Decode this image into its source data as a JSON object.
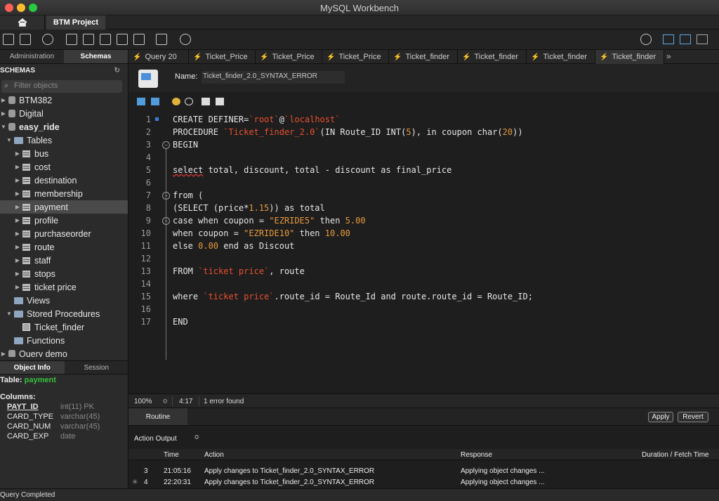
{
  "window": {
    "title": "MySQL Workbench"
  },
  "top_tabs": {
    "project": "BTM Project"
  },
  "sidebar": {
    "tabs": [
      "Administration",
      "Schemas"
    ],
    "header": "SCHEMAS",
    "filter_placeholder": "Filter objects",
    "tree": [
      {
        "label": "BTM382",
        "kind": "db",
        "expanded": false
      },
      {
        "label": "Digital",
        "kind": "db",
        "expanded": false
      },
      {
        "label": "easy_ride",
        "kind": "db",
        "expanded": true
      },
      {
        "label": "Tables",
        "kind": "folder",
        "expanded": true
      },
      {
        "label": "bus",
        "kind": "table"
      },
      {
        "label": "cost",
        "kind": "table"
      },
      {
        "label": "destination",
        "kind": "table"
      },
      {
        "label": "membership",
        "kind": "table"
      },
      {
        "label": "payment",
        "kind": "table",
        "selected": true
      },
      {
        "label": "profile",
        "kind": "table"
      },
      {
        "label": "purchaseorder",
        "kind": "table"
      },
      {
        "label": "route",
        "kind": "table"
      },
      {
        "label": "staff",
        "kind": "table"
      },
      {
        "label": "stops",
        "kind": "table"
      },
      {
        "label": "ticket price",
        "kind": "table"
      },
      {
        "label": "Views",
        "kind": "folder"
      },
      {
        "label": "Stored Procedures",
        "kind": "folder",
        "expanded": true
      },
      {
        "label": "Ticket_finder",
        "kind": "proc"
      },
      {
        "label": "Functions",
        "kind": "folder"
      },
      {
        "label": "Query demo",
        "kind": "db"
      }
    ],
    "info_tabs": [
      "Object Info",
      "Session"
    ],
    "info": {
      "table_label": "Table:",
      "table_name": "payment",
      "columns_label": "Columns:",
      "columns": [
        {
          "name": "PAYT_ID",
          "type": "int(11) PK",
          "pk": true
        },
        {
          "name": "CARD_TYPE",
          "type": "varchar(45)"
        },
        {
          "name": "CARD_NUM",
          "type": "varchar(45)"
        },
        {
          "name": "CARD_EXP",
          "type": "date"
        }
      ]
    }
  },
  "query_tabs": [
    "Query 20",
    "Ticket_Price",
    "Ticket_Price",
    "Ticket_Price",
    "Ticket_finder",
    "Ticket_finder",
    "Ticket_finder",
    "Ticket_finder"
  ],
  "query_tabs_more": "»",
  "routine": {
    "name_label": "Name:",
    "name_value": "Ticket_finder_2.0_SYNTAX_ERROR"
  },
  "editor": {
    "lines": [
      {
        "n": "1",
        "html": "CREATE DEFINER=<span class='str'>`root`</span>@<span class='str'>`localhost`</span>"
      },
      {
        "n": "2",
        "html": "PROCEDURE <span class='str'>`Ticket_finder_2.0`</span>(IN Route_ID INT(<span class='num'>5</span>), in coupon char(<span class='num'>20</span>))"
      },
      {
        "n": "3",
        "html": "BEGIN"
      },
      {
        "n": "4",
        "html": ""
      },
      {
        "n": "5",
        "html": "<span class='err'>select</span> total, discount, total - discount as final_price"
      },
      {
        "n": "6",
        "html": ""
      },
      {
        "n": "7",
        "html": "from ("
      },
      {
        "n": "8",
        "html": "(SELECT (price*<span class='num'>1.15</span>)) as total"
      },
      {
        "n": "9",
        "html": "case when coupon = <span class='str2'>\"EZRIDE5\"</span> then <span class='num'>5.00</span>"
      },
      {
        "n": "10",
        "html": "when coupon = <span class='str2'>\"EZRIDE10\"</span> then <span class='num'>10.00</span>"
      },
      {
        "n": "11",
        "html": "else <span class='num'>0.00</span> end as Discout"
      },
      {
        "n": "12",
        "html": ""
      },
      {
        "n": "13",
        "html": "FROM <span class='str'>`ticket price`</span>, route"
      },
      {
        "n": "14",
        "html": ""
      },
      {
        "n": "15",
        "html": "where <span class='str'>`ticket price`</span>.route_id = Route_Id and route.route_id = Route_ID;"
      },
      {
        "n": "16",
        "html": ""
      },
      {
        "n": "17",
        "html": "END"
      }
    ]
  },
  "editor_status": {
    "zoom": "100%",
    "cursor": "4:17",
    "errors": "1 error found"
  },
  "routine_bar": {
    "tab": "Routine",
    "apply": "Apply",
    "revert": "Revert"
  },
  "output": {
    "title": "Action Output",
    "selector": "≎",
    "headers": {
      "time": "Time",
      "action": "Action",
      "response": "Response",
      "duration": "Duration / Fetch Time"
    },
    "rows": [
      {
        "num": "3",
        "time": "21:05:16",
        "action": "Apply changes to Ticket_finder_2.0_SYNTAX_ERROR",
        "response": "Applying object changes ..."
      },
      {
        "num": "4",
        "time": "22:20:31",
        "action": "Apply changes to Ticket_finder_2.0_SYNTAX_ERROR",
        "response": "Applying object changes ..."
      }
    ]
  },
  "statusbar": {
    "text": "Query Completed"
  },
  "colors": {
    "accent": "#2f7fe0",
    "green": "#36c13d",
    "string": "#e8502f",
    "number": "#e89a3c"
  }
}
